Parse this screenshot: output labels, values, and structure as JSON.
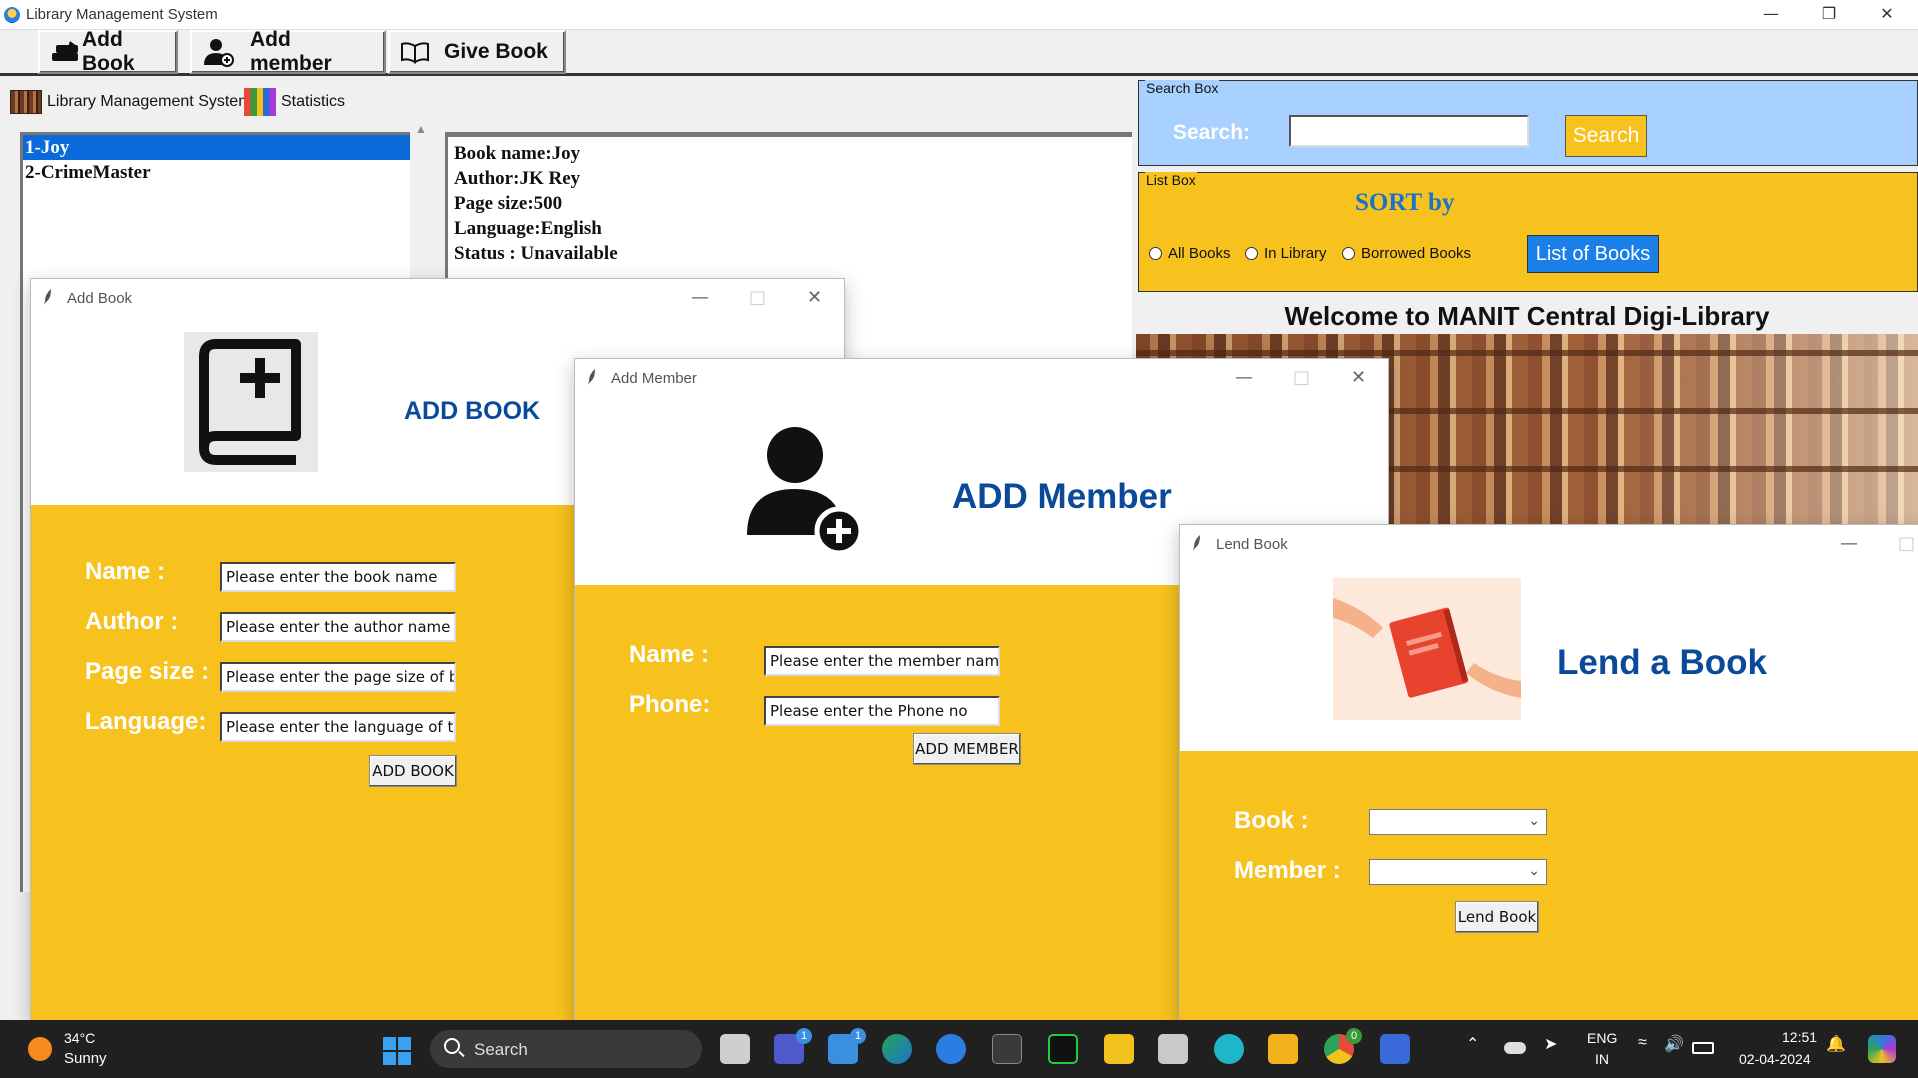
{
  "window": {
    "title": "Library Management System"
  },
  "toolbar": {
    "add_book": "Add Book",
    "add_member": "Add member",
    "give_book": "Give Book"
  },
  "tabs": {
    "main": "Library Management System",
    "stats": "Statistics"
  },
  "book_list": [
    "1-Joy",
    "2-CrimeMaster"
  ],
  "details": {
    "name": "Book name:Joy",
    "author": "Author:JK Rey",
    "pages": "Page size:500",
    "language": "Language:English",
    "status": "Status : Unavailable"
  },
  "search": {
    "group": "Search Box",
    "label": "Search:",
    "value": "",
    "button": "Search"
  },
  "listbox": {
    "group": "List Box",
    "sort_title": "SORT by",
    "radio_all": "All Books",
    "radio_in": "In Library",
    "radio_borrowed": "Borrowed Books",
    "button": "List of Books"
  },
  "welcome": "Welcome to MANIT Central Digi-Library",
  "add_book_win": {
    "title": "Add Book",
    "heading": "ADD BOOK",
    "name_label": "Name  :",
    "author_label": "Author :",
    "pages_label": "Page size :",
    "language_label": "Language:",
    "name_value": "Please enter the book name",
    "author_value": "Please enter the author name",
    "pages_value": "Please enter the page size of book",
    "language_value": "Please enter the language of the Bo",
    "button": "ADD BOOK"
  },
  "add_member_win": {
    "title": "Add Member",
    "heading": "ADD Member",
    "name_label": "Name :",
    "phone_label": "Phone:",
    "name_value": "Please enter the member name",
    "phone_value": "Please enter the Phone no",
    "button": "ADD MEMBER"
  },
  "lend_win": {
    "title": "Lend Book",
    "heading": "Lend a Book",
    "book_label": "Book :",
    "member_label": "Member :",
    "book_value": "",
    "member_value": "",
    "button": "Lend Book"
  },
  "taskbar": {
    "weather_temp": "34°C",
    "weather_desc": "Sunny",
    "search": "Search",
    "badge_teams": "1",
    "badge_store": "1",
    "badge_chrome": "0",
    "lang_1": "ENG",
    "lang_2": "IN",
    "time": "12:51",
    "date": "02-04-2024"
  },
  "colors": {
    "accent_yellow": "#f7c21e",
    "search_blue": "#a8d1ff",
    "heading_blue": "#0b4a99",
    "button_blue": "#1a7fe8"
  }
}
